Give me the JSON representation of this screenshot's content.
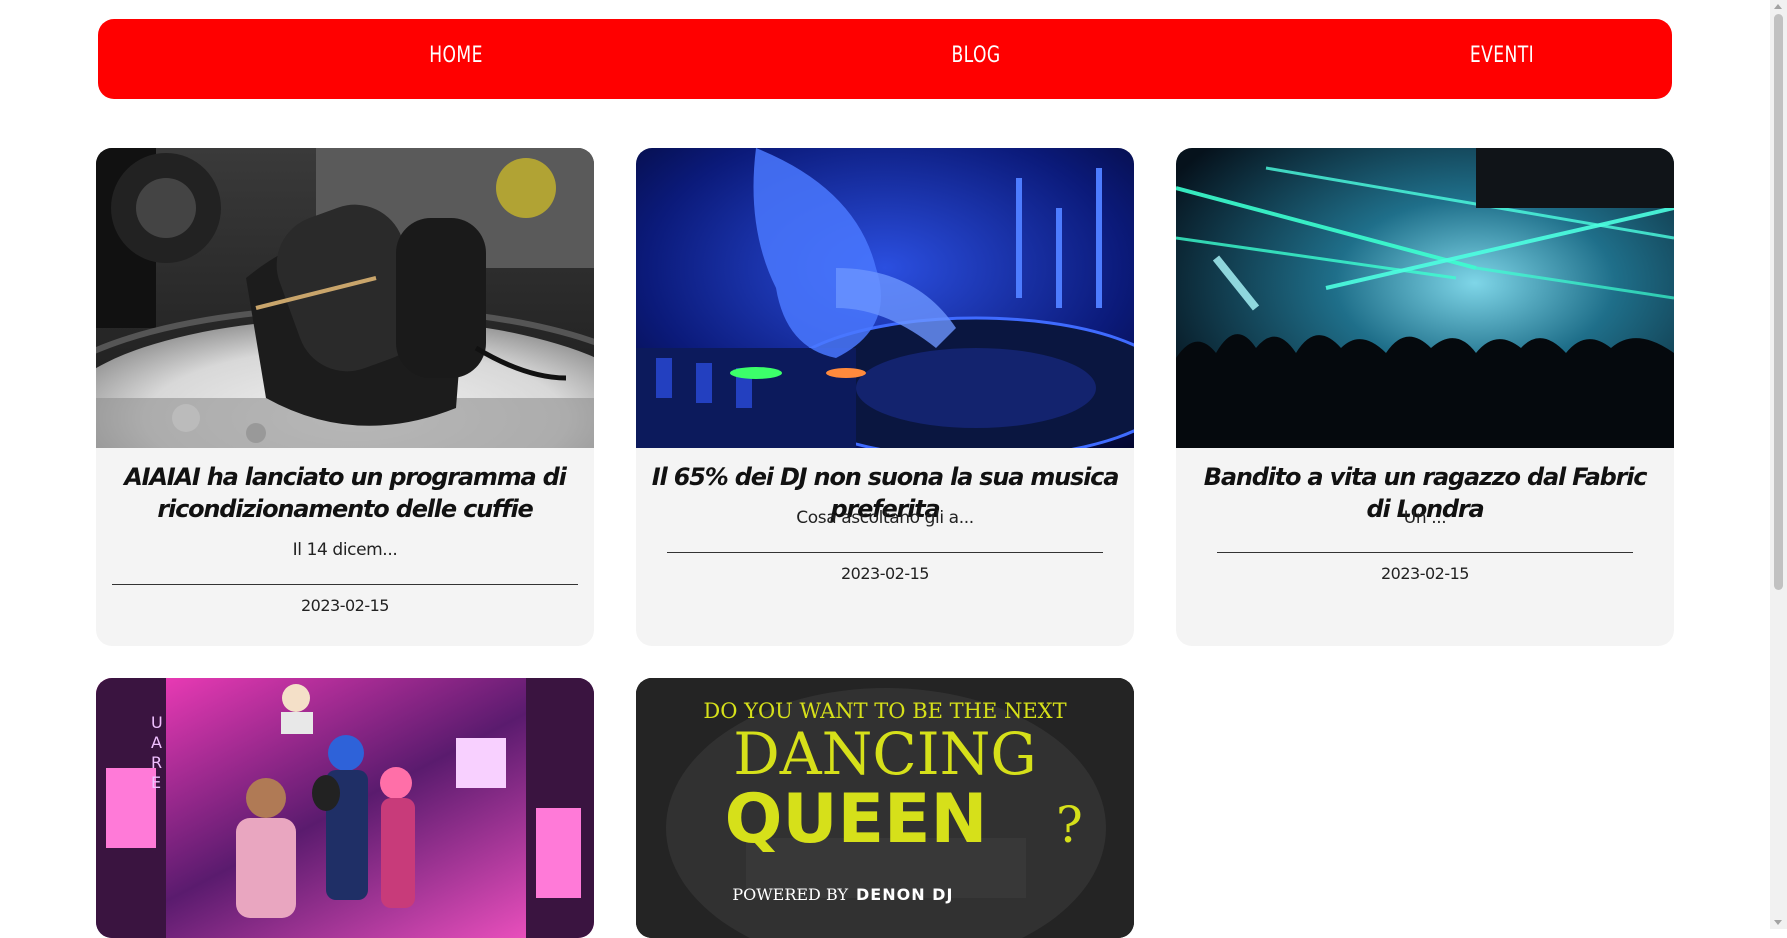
{
  "nav": {
    "items": [
      {
        "label": "HOME"
      },
      {
        "label": "BLOG"
      },
      {
        "label": "EVENTI"
      }
    ]
  },
  "posts": [
    {
      "title": "AIAIAI ha lanciato un programma di ricondizionamento delle cuffie",
      "excerpt": "Il 14 dicem...",
      "date": "2023-02-15",
      "image": "headphones-on-turntable"
    },
    {
      "title": "Il 65% dei DJ non suona la sua musica preferita",
      "excerpt": "Cosa ascoltano gli a...",
      "date": "2023-02-15",
      "image": "dj-hand-on-mixer"
    },
    {
      "title": "Bandito a vita un ragazzo dal Fabric di Londra",
      "excerpt": "Un ...",
      "date": "2023-02-15",
      "image": "club-crowd-lasers"
    },
    {
      "title": "",
      "excerpt": "",
      "date": "",
      "image": "animated-band-times-square"
    },
    {
      "title": "",
      "excerpt": "",
      "date": "",
      "image": "dancing-queen-poster"
    }
  ],
  "poster": {
    "line1": "DO YOU WANT TO BE THE NEXT",
    "line2": "DANCING",
    "line3": "QUEEN",
    "line3_suffix": "?",
    "powered": "POWERED  BY",
    "brand": "DENON DJ"
  },
  "colors": {
    "accent": "#ff0000",
    "card_bg": "#f4f4f4",
    "poster_yellow": "#d6e01a"
  }
}
